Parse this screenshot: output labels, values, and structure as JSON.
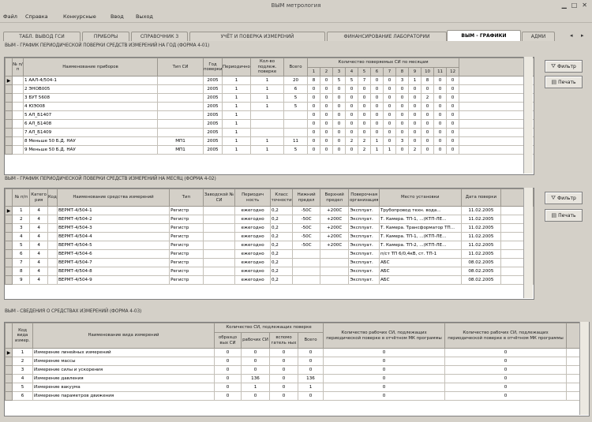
{
  "window": {
    "title": "ВЫМ метрология"
  },
  "menu": [
    "Файл",
    "Справка",
    "Конкурсные",
    "Ввод",
    "Выход"
  ],
  "tabs": [
    {
      "label": "ТАБЛ. ВЫВОД ГСИ"
    },
    {
      "label": "ПРИБОРЫ"
    },
    {
      "label": "СПРАВОЧНИК 3"
    },
    {
      "label": "УЧЁТ И ПОВЕРКА ИЗМЕРЕНИЙ"
    },
    {
      "label": "ФИНАНСИРОВАНИЕ ЛАБОРАТОРИИ"
    },
    {
      "label": "ВЫМ - ГРАФИКИ",
      "active": true
    },
    {
      "label": "АДМИ"
    }
  ],
  "section1": {
    "title": "ВЫМ - ГРАФИК ПЕРИОДИЧЕСКОЙ ПОВЕРКИ СРЕДСТВ ИЗМЕРЕНИЙ НА ГОД (ФОРМА 4-01)",
    "headers": {
      "num": "№ п/п",
      "name": "Наименование приборов",
      "type": "Тип СИ",
      "year": "Год поверки",
      "period": "Периодичность",
      "qty_year": "Кол-во подлеж. поверке",
      "total": "Всего",
      "months": "Количество поверяемых СИ по месяцам"
    },
    "month_cols": [
      "1",
      "2",
      "3",
      "4",
      "5",
      "6",
      "7",
      "8",
      "9",
      "10",
      "11",
      "12"
    ],
    "rows": [
      {
        "name": "1 ААЛ-4/504-1",
        "type": "",
        "year": "2005",
        "period": "1",
        "qty": "1",
        "total": "20",
        "m": [
          "8",
          "0",
          "5",
          "5",
          "7",
          "0",
          "0",
          "3",
          "1",
          "8",
          "0",
          "0"
        ]
      },
      {
        "name": "2 ЭНОВ005",
        "type": "",
        "year": "2005",
        "period": "1",
        "qty": "1",
        "total": "6",
        "m": [
          "0",
          "0",
          "0",
          "0",
          "0",
          "0",
          "0",
          "0",
          "0",
          "0",
          "0",
          "0"
        ]
      },
      {
        "name": "3 БУТ 5608",
        "type": "",
        "year": "2005",
        "period": "1",
        "qty": "1",
        "total": "5",
        "m": [
          "0",
          "0",
          "0",
          "0",
          "0",
          "0",
          "0",
          "0",
          "0",
          "2",
          "0",
          "0"
        ]
      },
      {
        "name": "4 ЮЭ008",
        "type": "",
        "year": "2005",
        "period": "1",
        "qty": "1",
        "total": "5",
        "m": [
          "0",
          "0",
          "0",
          "0",
          "0",
          "0",
          "0",
          "0",
          "0",
          "0",
          "0",
          "0"
        ]
      },
      {
        "name": "5 АЛ_Б1407",
        "type": "",
        "year": "2005",
        "period": "1",
        "qty": "",
        "total": "",
        "m": [
          "0",
          "0",
          "0",
          "0",
          "0",
          "0",
          "0",
          "0",
          "0",
          "0",
          "0",
          "0"
        ]
      },
      {
        "name": "6 АЛ_Б1408",
        "type": "",
        "year": "2005",
        "period": "1",
        "qty": "",
        "total": "",
        "m": [
          "0",
          "0",
          "0",
          "0",
          "0",
          "0",
          "0",
          "0",
          "0",
          "0",
          "0",
          "0"
        ]
      },
      {
        "name": "7 АЛ_Б1409",
        "type": "",
        "year": "2005",
        "period": "1",
        "qty": "",
        "total": "",
        "m": [
          "0",
          "0",
          "0",
          "0",
          "0",
          "0",
          "0",
          "0",
          "0",
          "0",
          "0",
          "0"
        ]
      },
      {
        "name": "8 Меньше 50 Б.Д. НАУ",
        "type": "МП1",
        "year": "2005",
        "period": "1",
        "qty": "1",
        "total": "11",
        "m": [
          "0",
          "0",
          "0",
          "2",
          "2",
          "1",
          "0",
          "3",
          "0",
          "0",
          "0",
          "0"
        ]
      },
      {
        "name": "9 Меньше 50 Б.Д. НАУ",
        "type": "МП1",
        "year": "2005",
        "period": "1",
        "qty": "1",
        "total": "5",
        "m": [
          "0",
          "0",
          "0",
          "0",
          "2",
          "1",
          "1",
          "0",
          "2",
          "0",
          "0",
          "0"
        ]
      }
    ]
  },
  "section2": {
    "title": "ВЫМ - ГРАФИК ПЕРИОДИЧЕСКОЙ ПОВЕРКИ СРЕДСТВ ИЗМЕРЕНИЙ НА МЕСЯЦ (ФОРМА 4-02)",
    "headers": {
      "num": "№ п/п",
      "cat": "Катего рия",
      "code": "Код",
      "name": "Наименование средства измерений",
      "type": "Тип",
      "serial": "Заводской № СИ",
      "period": "Периодич ность",
      "method": "Класс точности",
      "low": "Нижний предел",
      "high": "Верхний предел",
      "place": "Поверочная организация",
      "location": "Место установки",
      "date": "Дата поверки"
    },
    "rows": [
      {
        "num": "1",
        "cat": "4",
        "name": "ВЕРМТ-4/504-1",
        "type": "Регистр",
        "period": "ежегодно",
        "method": "0,2",
        "low": "-50С",
        "high": "+200С",
        "place": "Эксплуат.",
        "location": "Трубопровод техн. вода...",
        "date": "11.02.2005"
      },
      {
        "num": "2",
        "cat": "4",
        "name": "ВЕРМТ-4/504-2",
        "type": "Регистр",
        "period": "ежегодно",
        "method": "0,2",
        "low": "-50С",
        "high": "+200С",
        "place": "Эксплуат.",
        "location": "Т. Камера. ТП-1, ...(КТП-ЛЕ...",
        "date": "11.02.2005"
      },
      {
        "num": "3",
        "cat": "4",
        "name": "ВЕРМТ-4/504-3",
        "type": "Регистр",
        "period": "ежегодно",
        "method": "0,2",
        "low": "-50С",
        "high": "+200С",
        "place": "Эксплуат.",
        "location": "Т. Камера. Трансформатор ТП...",
        "date": "11.02.2005"
      },
      {
        "num": "4",
        "cat": "4",
        "name": "ВЕРМТ-4/504-4",
        "type": "Регистр",
        "period": "ежегодно",
        "method": "0,2",
        "low": "-50С",
        "high": "+200С",
        "place": "Эксплуат.",
        "location": "Т. Камера. ТП-1, ...(КТП-ЛЕ...",
        "date": "11.02.2005"
      },
      {
        "num": "5",
        "cat": "4",
        "name": "ВЕРМТ-4/504-5",
        "type": "Регистр",
        "period": "ежегодно",
        "method": "0,2",
        "low": "-50С",
        "high": "+200С",
        "place": "Эксплуат.",
        "location": "Т. Камера. ТП-2, ...(КТП-ЛЕ...",
        "date": "11.02.2005"
      },
      {
        "num": "6",
        "cat": "4",
        "name": "ВЕРМТ-4/504-6",
        "type": "Регистр",
        "period": "ежегодно",
        "method": "0,2",
        "low": "",
        "high": "",
        "place": "Эксплуат.",
        "location": "п/ст ТП 6/0,4кВ, ст. ТП-1",
        "date": "11.02.2005"
      },
      {
        "num": "7",
        "cat": "4",
        "name": "ВЕРМТ-4/504-7",
        "type": "Регистр",
        "period": "ежегодно",
        "method": "0,2",
        "low": "",
        "high": "",
        "place": "Эксплуат.",
        "location": "АБС",
        "date": "08.02.2005"
      },
      {
        "num": "8",
        "cat": "4",
        "name": "ВЕРМТ-4/504-8",
        "type": "Регистр",
        "period": "ежегодно",
        "method": "0,2",
        "low": "",
        "high": "",
        "place": "Эксплуат.",
        "location": "АБС",
        "date": "08.02.2005"
      },
      {
        "num": "9",
        "cat": "4",
        "name": "ВЕРМТ-4/504-9",
        "type": "Регистр",
        "period": "ежегодно",
        "method": "0,2",
        "low": "",
        "high": "",
        "place": "Эксплуат.",
        "location": "АБС",
        "date": "08.02.2005"
      }
    ]
  },
  "section3": {
    "title": "ВЫМ - СВЕДЕНИЯ О СРЕДСТВАХ ИЗМЕРЕНИЙ (ФОРМА 4-03)",
    "headers": {
      "code": "Код вида измер.",
      "name": "Наименование вида измерений",
      "qty_group": "Количество СИ, подлежащих поверке",
      "c1": "образцо вых СИ",
      "c2": "рабочих СИ",
      "c3": "вспомо гатель ных",
      "c4": "Всего",
      "prog1": "Количество рабочих СИ, подлежащих периодической поверке в отчётном МК программы",
      "prog2": "Количество рабочих СИ, подлежащих периодической поверке в отчётном МК программы"
    },
    "rows": [
      {
        "code": "1",
        "name": "Измерение линейных измерений",
        "c1": "0",
        "c2": "0",
        "c3": "0",
        "c4": "0",
        "p1": "0",
        "p2": "0"
      },
      {
        "code": "2",
        "name": "Измерение массы",
        "c1": "0",
        "c2": "0",
        "c3": "0",
        "c4": "0",
        "p1": "0",
        "p2": "0"
      },
      {
        "code": "3",
        "name": "Измерение силы и ускорения",
        "c1": "0",
        "c2": "0",
        "c3": "0",
        "c4": "0",
        "p1": "0",
        "p2": "0"
      },
      {
        "code": "4",
        "name": "Измерение давления",
        "c1": "0",
        "c2": "136",
        "c3": "0",
        "c4": "136",
        "p1": "0",
        "p2": "0"
      },
      {
        "code": "5",
        "name": "Измерение вакуума",
        "c1": "0",
        "c2": "1",
        "c3": "0",
        "c4": "1",
        "p1": "0",
        "p2": "0"
      },
      {
        "code": "6",
        "name": "Измерение параметров движения",
        "c1": "0",
        "c2": "0",
        "c3": "0",
        "c4": "0",
        "p1": "0",
        "p2": "0"
      }
    ]
  },
  "buttons": {
    "filter": "Фильтр",
    "print": "Печать"
  }
}
